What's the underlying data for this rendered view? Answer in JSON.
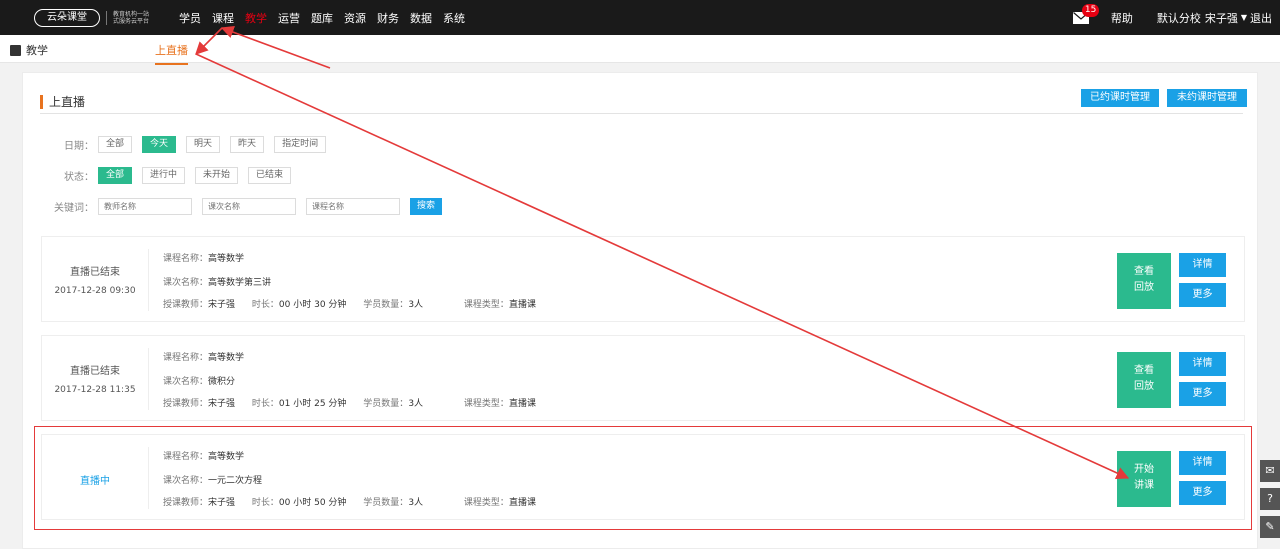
{
  "topbar": {
    "logo_text": "云朵课堂",
    "logo_tagline": "教育机构一站式服务云平台",
    "nav": [
      "学员",
      "课程",
      "教学",
      "运营",
      "题库",
      "资源",
      "财务",
      "数据",
      "系统"
    ],
    "active_nav": "教学",
    "mail_badge": "15",
    "help": "帮助",
    "school": "默认分校",
    "user": "宋子强",
    "logout": "退出"
  },
  "subbar": {
    "section": "教学",
    "tab": "上直播"
  },
  "panel": {
    "title": "上直播",
    "btn_booked": "已约课时管理",
    "btn_unbooked": "未约课时管理"
  },
  "filters": {
    "date_label": "日期：",
    "date_options": [
      "全部",
      "今天",
      "明天",
      "昨天",
      "指定时间"
    ],
    "date_selected": "今天",
    "status_label": "状态：",
    "status_options": [
      "全部",
      "进行中",
      "未开始",
      "已结束"
    ],
    "status_selected": "全部",
    "keyword_label": "关键词：",
    "placeholders": [
      "教师名称",
      "课次名称",
      "课程名称"
    ],
    "search": "搜索"
  },
  "labels": {
    "course": "课程名称：",
    "lesson": "课次名称：",
    "teacher": "授课教师：",
    "duration": "时长：",
    "students": "学员数量：",
    "type": "课程类型：",
    "details": "详情",
    "more": "更多"
  },
  "lessons": [
    {
      "status": "直播已结束",
      "time": "2017-12-28 09:30",
      "course": "高等数学",
      "lesson": "高等数学第三讲",
      "teacher": "宋子强",
      "duration": "00 小时 30 分钟",
      "students": "3人",
      "type": "直播课",
      "action": [
        "查看",
        "回放"
      ]
    },
    {
      "status": "直播已结束",
      "time": "2017-12-28 11:35",
      "course": "高等数学",
      "lesson": "微积分",
      "teacher": "宋子强",
      "duration": "01 小时 25 分钟",
      "students": "3人",
      "type": "直播课",
      "action": [
        "查看",
        "回放"
      ]
    },
    {
      "status": "直播中",
      "time": "",
      "course": "高等数学",
      "lesson": "一元二次方程",
      "teacher": "宋子强",
      "duration": "00 小时 50 分钟",
      "students": "3人",
      "type": "直播课",
      "action": [
        "开始",
        "讲课"
      ]
    }
  ],
  "colors": {
    "accent": "#e8731f",
    "green": "#2bba8e",
    "blue": "#1aa1e6",
    "annotation": "#e43a3a"
  }
}
